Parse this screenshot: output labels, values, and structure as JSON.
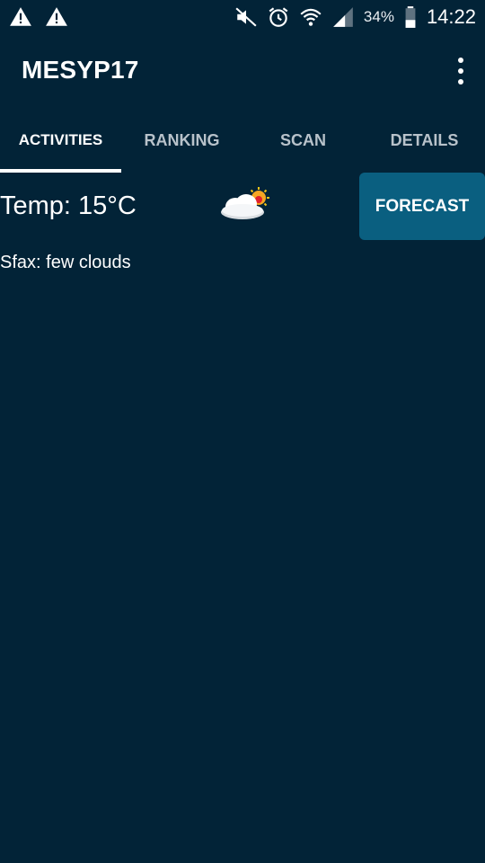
{
  "status_bar": {
    "left_icons": [
      "warning-icon",
      "warning-icon"
    ],
    "right_icons": [
      "mute-icon",
      "alarm-icon",
      "wifi-icon",
      "signal-icon",
      "battery-icon"
    ],
    "battery_percent": "34%",
    "time": "14:22"
  },
  "app_bar": {
    "title": "MESYP17",
    "menu_icon": "overflow-menu-icon"
  },
  "tabs": [
    {
      "label": "ACTIVITIES",
      "active": true
    },
    {
      "label": "RANKING",
      "active": false
    },
    {
      "label": "SCAN",
      "active": false
    },
    {
      "label": "DETAILS",
      "active": false
    }
  ],
  "weather": {
    "temp_text": "Temp: 15°C",
    "icon": "few-clouds-icon",
    "location_text": "Sfax: few clouds",
    "forecast_label": "FORECAST"
  },
  "colors": {
    "background": "#022337",
    "button": "#0a5f80",
    "tab_inactive": "#b8c2ca",
    "indicator": "#ffffff"
  }
}
